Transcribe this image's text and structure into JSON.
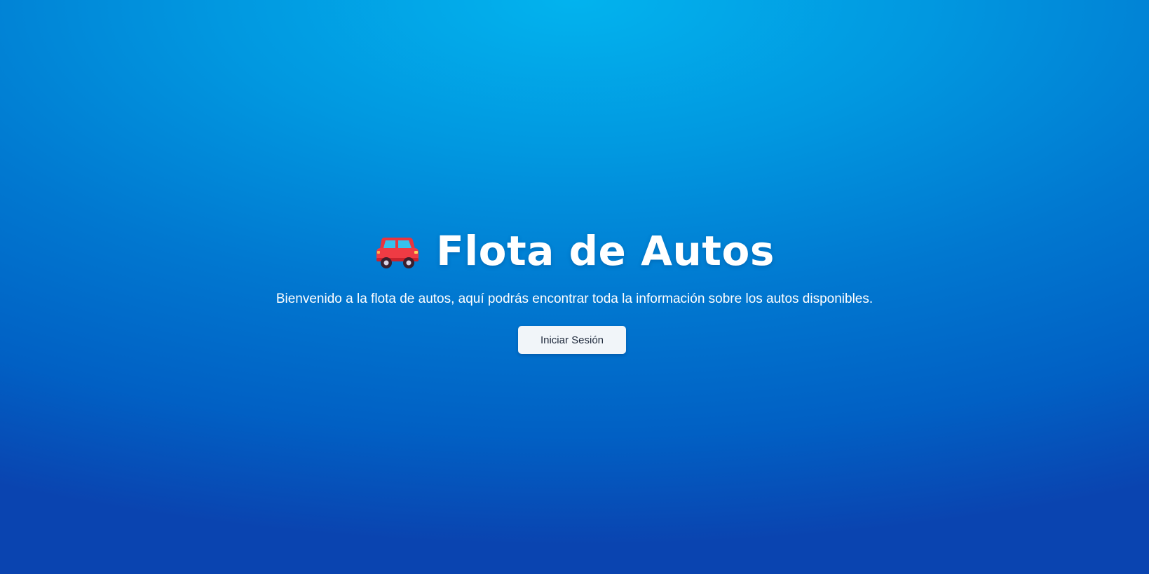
{
  "page": {
    "icon": "car-icon",
    "title": "Flota de Autos",
    "subtitle": "Bienvenido a la flota de autos, aquí podrás encontrar toda la información sobre los autos disponibles.",
    "login_label": "Iniciar Sesión"
  },
  "colors": {
    "background_top": "#02b3ee",
    "background_bottom": "#0a44b0",
    "button_bg": "#f1f5f9",
    "button_text": "#1e293b",
    "title_text": "#ffffff"
  }
}
